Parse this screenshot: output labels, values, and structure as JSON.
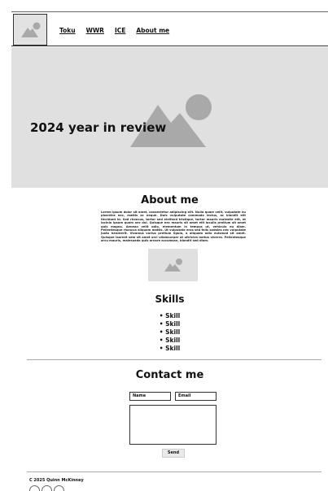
{
  "nav": {
    "links": [
      "Toku",
      "WWR",
      "ICE",
      "About me"
    ]
  },
  "hero": {
    "title": "2024 year in review"
  },
  "about": {
    "title": "About me",
    "body": "Lorem ipsum dolor sit amet, consectetur adipiscing elit. Nulla quam velit, vulputate eu pharetra nec, mattis ac neque. Duis vulputate commodo lectus, ac blandit elit tincidunt id. Sed rhoncus, tortor sed eleifend tristique, tortor mauris molestie elit, et lacinia ipsum quam nec dui. Quisque nec mauris sit amet elit iaculis pretium sit amet quis magna. Aenean velit odio, elementum in tempus ut, vehicula eu diam. Pellentesque rhoncus aliquam mattis. Ut vulputate eros sed felis sodales nec vulputate justo hendrerit. Vivamus varius pretium ligula, a aliquam odio euismod sit amet. Quisque laoreet sem sit amet orci ullamcorper at ultricies metus viverra. Pellentesque arcu mauris, malesuada quis ornare accumsan, blandit sed diam."
  },
  "skills": {
    "title": "Skills",
    "items": [
      "Skill",
      "Skill",
      "Skill",
      "Skill",
      "Skill"
    ]
  },
  "contact": {
    "title": "Contact me",
    "name_placeholder": "Name",
    "email_placeholder": "Email",
    "send_label": "Send"
  },
  "footer": {
    "copyright": "C 2025 Quinn McKinney",
    "social_icons": [
      "social-icon-1",
      "social-icon-2",
      "social-icon-3"
    ]
  },
  "colors": {
    "placeholder_gray": "#e0e0e0",
    "icon_gray": "#a9a9a9"
  }
}
